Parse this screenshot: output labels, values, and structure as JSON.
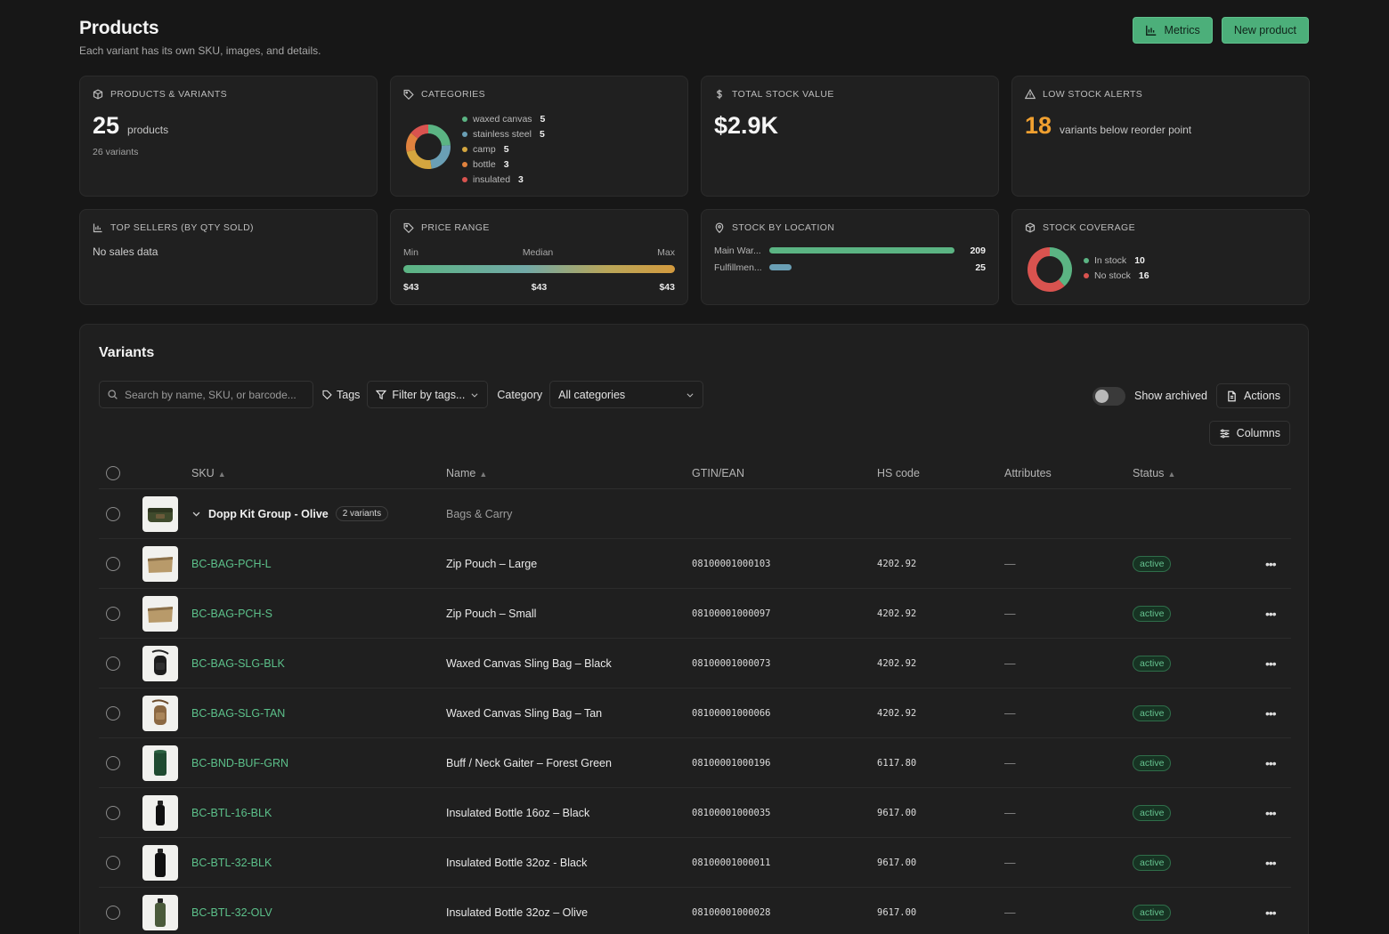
{
  "header": {
    "title": "Products",
    "subtitle": "Each variant has its own SKU, images, and details.",
    "metrics_label": "Metrics",
    "new_product_label": "New product"
  },
  "cards": {
    "products": {
      "title": "Products & Variants",
      "count": "25",
      "count_label": "products",
      "variants": "26 variants"
    },
    "categories": {
      "title": "Categories",
      "items": [
        {
          "name": "waxed canvas",
          "count": "5",
          "color": "#5bb483"
        },
        {
          "name": "stainless steel",
          "count": "5",
          "color": "#6a9fb5"
        },
        {
          "name": "camp",
          "count": "5",
          "color": "#d4a63f"
        },
        {
          "name": "bottle",
          "count": "3",
          "color": "#e0823e"
        },
        {
          "name": "insulated",
          "count": "3",
          "color": "#d9534f"
        }
      ]
    },
    "stock_value": {
      "title": "Total Stock Value",
      "value": "$2.9K"
    },
    "low_stock": {
      "title": "Low Stock Alerts",
      "value": "18",
      "label": "variants below reorder point",
      "color": "#f0a030"
    },
    "top_sellers": {
      "title": "Top Sellers (by qty sold)",
      "empty": "No sales data"
    },
    "price_range": {
      "title": "Price Range",
      "min_label": "Min",
      "median_label": "Median",
      "max_label": "Max",
      "min": "$43",
      "median": "$43",
      "max": "$43"
    },
    "stock_location": {
      "title": "Stock by Location",
      "items": [
        {
          "name": "Main War...",
          "value": "209",
          "fraction": 1.0,
          "color": "#5bb483"
        },
        {
          "name": "Fulfillmen...",
          "value": "25",
          "fraction": 0.12,
          "color": "#6a9fb5"
        }
      ]
    },
    "coverage": {
      "title": "Stock Coverage",
      "items": [
        {
          "name": "In stock",
          "count": "10",
          "color": "#5bb483"
        },
        {
          "name": "No stock",
          "count": "16",
          "color": "#d9534f"
        }
      ]
    }
  },
  "variants": {
    "title": "Variants",
    "search_placeholder": "Search by name, SKU, or barcode...",
    "tags_label": "Tags",
    "tags_filter": "Filter by tags...",
    "category_label": "Category",
    "category_value": "All categories",
    "show_archived": "Show archived",
    "actions_label": "Actions",
    "columns_label": "Columns",
    "columns": {
      "sku": "SKU",
      "name": "Name",
      "gtin": "GTIN/EAN",
      "hs": "HS code",
      "attributes": "Attributes",
      "status": "Status"
    },
    "group": {
      "name": "Dopp Kit Group - Olive",
      "badge": "2 variants",
      "category": "Bags & Carry"
    },
    "rows": [
      {
        "sku": "BC-BAG-PCH-L",
        "name": "Zip Pouch – Large",
        "gtin": "08100001000103",
        "hs": "4202.92",
        "attr": "—",
        "status": "active",
        "thumb": "pouch"
      },
      {
        "sku": "BC-BAG-PCH-S",
        "name": "Zip Pouch – Small",
        "gtin": "08100001000097",
        "hs": "4202.92",
        "attr": "—",
        "status": "active",
        "thumb": "pouch"
      },
      {
        "sku": "BC-BAG-SLG-BLK",
        "name": "Waxed Canvas Sling Bag – Black",
        "gtin": "08100001000073",
        "hs": "4202.92",
        "attr": "—",
        "status": "active",
        "thumb": "sling-black"
      },
      {
        "sku": "BC-BAG-SLG-TAN",
        "name": "Waxed Canvas Sling Bag – Tan",
        "gtin": "08100001000066",
        "hs": "4202.92",
        "attr": "—",
        "status": "active",
        "thumb": "sling-tan"
      },
      {
        "sku": "BC-BND-BUF-GRN",
        "name": "Buff / Neck Gaiter – Forest Green",
        "gtin": "08100001000196",
        "hs": "6117.80",
        "attr": "—",
        "status": "active",
        "thumb": "buff"
      },
      {
        "sku": "BC-BTL-16-BLK",
        "name": "Insulated Bottle 16oz – Black",
        "gtin": "08100001000035",
        "hs": "9617.00",
        "attr": "—",
        "status": "active",
        "thumb": "bottle-black-small"
      },
      {
        "sku": "BC-BTL-32-BLK",
        "name": "Insulated Bottle 32oz - Black",
        "gtin": "08100001000011",
        "hs": "9617.00",
        "attr": "—",
        "status": "active",
        "thumb": "bottle-black"
      },
      {
        "sku": "BC-BTL-32-OLV",
        "name": "Insulated Bottle 32oz – Olive",
        "gtin": "08100001000028",
        "hs": "9617.00",
        "attr": "—",
        "status": "active",
        "thumb": "bottle-olive"
      }
    ]
  }
}
